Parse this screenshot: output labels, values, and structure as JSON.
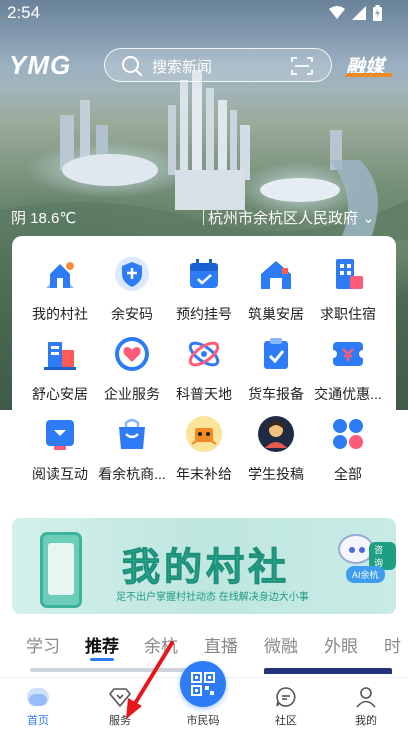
{
  "status_bar": {
    "time": "2:54"
  },
  "header": {
    "logo": "YMG",
    "search_placeholder": "搜索新闻",
    "rongmei_label": "融媒"
  },
  "hero": {
    "weather": "阴 18.6℃",
    "government": "杭州市余杭区人民政府 ⌄"
  },
  "services": [
    {
      "label": "我的村社",
      "icon": "village-house-icon",
      "color": "#2d7cf6"
    },
    {
      "label": "余安码",
      "icon": "shield-code-icon",
      "color": "#2d7cf6"
    },
    {
      "label": "预约挂号",
      "icon": "calendar-icon",
      "color": "#2d7cf6"
    },
    {
      "label": "筑巢安居",
      "icon": "house-icon",
      "color": "#2d7cf6"
    },
    {
      "label": "求职住宿",
      "icon": "building-icon",
      "color": "#2d7cf6"
    },
    {
      "label": "舒心安居",
      "icon": "apartment-icon",
      "color": "#2d7cf6"
    },
    {
      "label": "企业服务",
      "icon": "heart-hands-icon",
      "color": "#2d7cf6"
    },
    {
      "label": "科普天地",
      "icon": "atom-icon",
      "color": "#2d7cf6"
    },
    {
      "label": "货车报备",
      "icon": "clipboard-check-icon",
      "color": "#2d7cf6"
    },
    {
      "label": "交通优惠...",
      "icon": "ticket-icon",
      "color": "#2d7cf6"
    },
    {
      "label": "阅读互动",
      "icon": "reading-icon",
      "color": "#2d7cf6"
    },
    {
      "label": "看余杭商...",
      "icon": "shopping-bag-icon",
      "color": "#2d7cf6"
    },
    {
      "label": "年末补给",
      "icon": "gift-character-icon",
      "color": "#f2b21b"
    },
    {
      "label": "学生投稿",
      "icon": "student-avatar-icon",
      "color": "#1f2a44"
    },
    {
      "label": "全部",
      "icon": "all-grid-icon",
      "color": "#2d7cf6"
    }
  ],
  "banner": {
    "title": "我的村社",
    "subtitle": "足不出户掌握村社动态 在线解决身边大小事",
    "ai_tag": "AI余杭",
    "ask_tag": "咨询"
  },
  "tabs": [
    "学习",
    "推荐",
    "余杭",
    "直播",
    "微融",
    "外眼",
    "时"
  ],
  "active_tab": "推荐",
  "bottom_nav": {
    "home": "首页",
    "service": "服务",
    "citizen_code": "市民码",
    "community": "社区",
    "mine": "我的"
  },
  "accent_color": "#2d7cf6"
}
